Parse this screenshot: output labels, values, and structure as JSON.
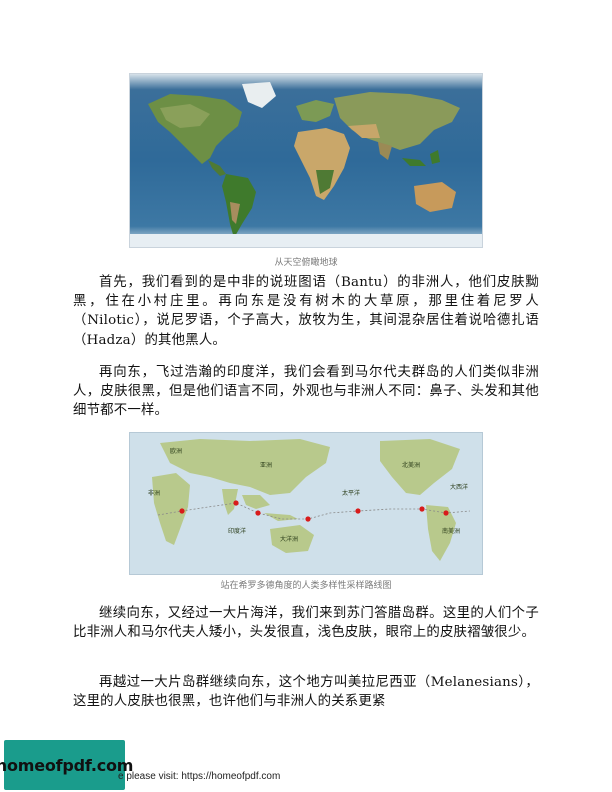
{
  "figures": [
    {
      "caption": "从天空俯瞰地球"
    },
    {
      "caption": "站在希罗多德角度的人类多样性采样路线图",
      "labels": {
        "europe": "欧洲",
        "asia": "亚洲",
        "north_america": "北美洲",
        "africa": "非洲",
        "pacific": "太平洋",
        "atlantic": "大西洋",
        "indian_ocean": "印度洋",
        "oceania": "大洋洲",
        "south_america": "南美洲"
      }
    }
  ],
  "paragraphs": [
    "首先，我们看到的是中非的说班图语（Bantu）的非洲人，他们皮肤黝黑，住在小村庄里。再向东是没有树木的大草原，那里住着尼罗人（Nilotic），说尼罗语，个子高大，放牧为生，其间混杂居住着说哈德扎语（Hadza）的其他黑人。",
    "再向东，飞过浩瀚的印度洋，我们会看到马尔代夫群岛的人们类似非洲人，皮肤很黑，但是他们语言不同，外观也与非洲人不同：鼻子、头发和其他细节都不一样。",
    "继续向东，又经过一大片海洋，我们来到苏门答腊岛群。这里的人们个子比非洲人和马尔代夫人矮小，头发很直，浅色皮肤，眼帘上的皮肤褶皱很少。",
    "再越过一大片岛群继续向东，这个地方叫美拉尼西亚（Melanesians），这里的人皮肤也很黑，也许他们与非洲人的关系更紧"
  ],
  "footer": {
    "logo_text": "homeofpdf.com",
    "note": "e please visit: https://homeofpdf.com"
  },
  "colors": {
    "ocean_satellite": "#2f6a99",
    "land_green": "#5f8a3c",
    "desert": "#c9a76a",
    "route_marker": "#d81b1b",
    "logo_bg": "#1a9c8c"
  }
}
